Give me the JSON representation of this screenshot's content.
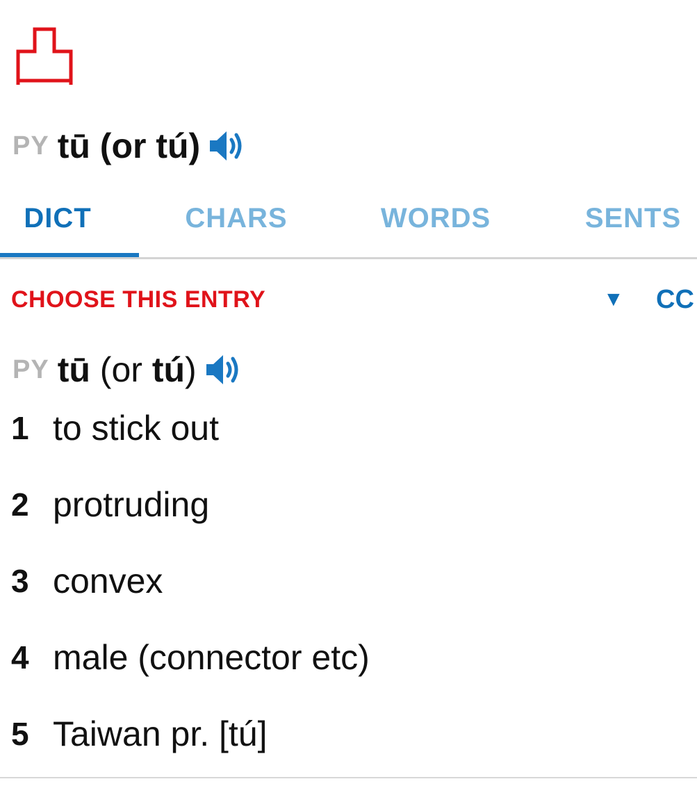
{
  "headword": {
    "character_icon": "tu-character-glyph",
    "py_tag": "PY",
    "pinyin": "tū (or tú)",
    "audio_icon": "speaker-icon"
  },
  "tabs": [
    {
      "label": "DICT",
      "active": true
    },
    {
      "label": "CHARS",
      "active": false
    },
    {
      "label": "WORDS",
      "active": false
    },
    {
      "label": "SENTS",
      "active": false
    }
  ],
  "entry": {
    "choose_label": "CHOOSE THIS ENTRY",
    "dropdown_glyph": "▼",
    "source_label": "CC",
    "py_tag": "PY",
    "pinyin_main": "tū",
    "pinyin_or": " (or ",
    "pinyin_alt": "tú",
    "pinyin_close": ")",
    "definitions": [
      {
        "num": "1",
        "text": "to stick out"
      },
      {
        "num": "2",
        "text": "protruding"
      },
      {
        "num": "3",
        "text": "convex"
      },
      {
        "num": "4",
        "text": "male (connector etc)"
      },
      {
        "num": "5",
        "text": "Taiwan pr. [tú]"
      }
    ]
  },
  "colors": {
    "accent_blue": "#1070b8",
    "inactive_tab": "#78b4dc",
    "red": "#e0131a",
    "muted_gray": "#b4b4b4"
  }
}
